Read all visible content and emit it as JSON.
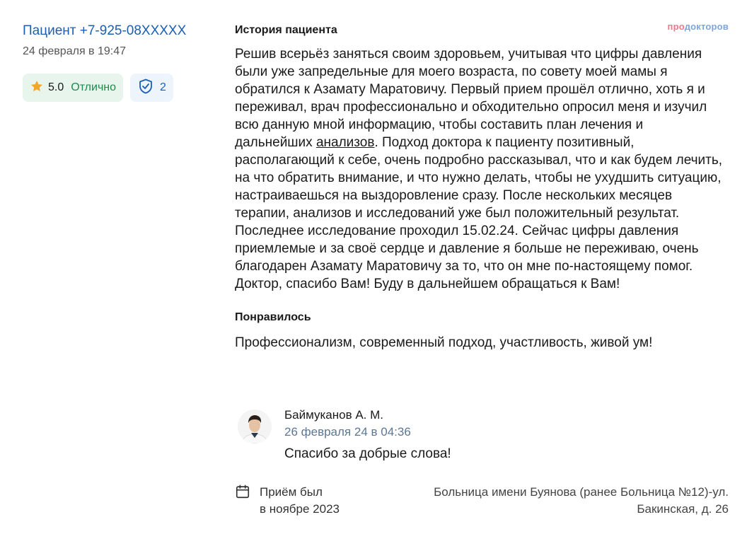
{
  "review": {
    "author": "Пациент +7-925-08XXXXX",
    "date": "24 февраля в 19:47",
    "rating_value": "5.0",
    "rating_word": "Отлично",
    "verify_count": "2",
    "rating_color": "#1e8a4c",
    "accent": "#1a5fb4"
  },
  "brand": {
    "part1": "про",
    "part2": "докторов"
  },
  "history": {
    "heading": "История пациента",
    "text_before_link": "Решив всерьёз заняться своим здоровьем, учитывая что цифры давления были уже запредельные для моего возраста, по совету моей мамы я обратился к Азамату Маратовичу. Первый прием прошёл отлично, хоть я и переживал, врач профессионально и обходительно опросил меня и изучил всю данную мной информацию, чтобы составить план лечения и дальнейших ",
    "link": "анализов",
    "text_after_link": ". Подход доктора к пациенту позитивный, располагающий к себе, очень подробно рассказывал, что и как будем лечить, на что обратить внимание, и что нужно делать, чтобы не ухудшить ситуацию, настраиваешься на выздоровление сразу. После нескольких месяцев терапии, анализов и исследований уже был положительный результат. Последнее исследование проходил 15.02.24. Сейчас цифры давления приемлемые и за своё сердце и давление я больше не переживаю, очень благодарен Азамату Маратовичу за то, что он мне по-настоящему помог. Доктор, спасибо Вам! Буду в дальнейшем обращаться к Вам!"
  },
  "liked": {
    "heading": "Понравилось",
    "text": "Профессионализм, современный подход, участливость, живой ум!"
  },
  "reply": {
    "name": "Баймуканов А. М.",
    "date": "26 февраля 24 в 04:36",
    "text": "Спасибо за добрые слова!"
  },
  "visit": {
    "line1": "Приём был",
    "line2": "в ноябре 2023",
    "clinic_line1": "Больница имени Буянова (ранее Больница №12)-ул.",
    "clinic_line2": "Бакинская, д. 26"
  },
  "icons": [
    "star-icon",
    "shield-check-icon",
    "calendar-icon",
    "doctor-avatar"
  ]
}
